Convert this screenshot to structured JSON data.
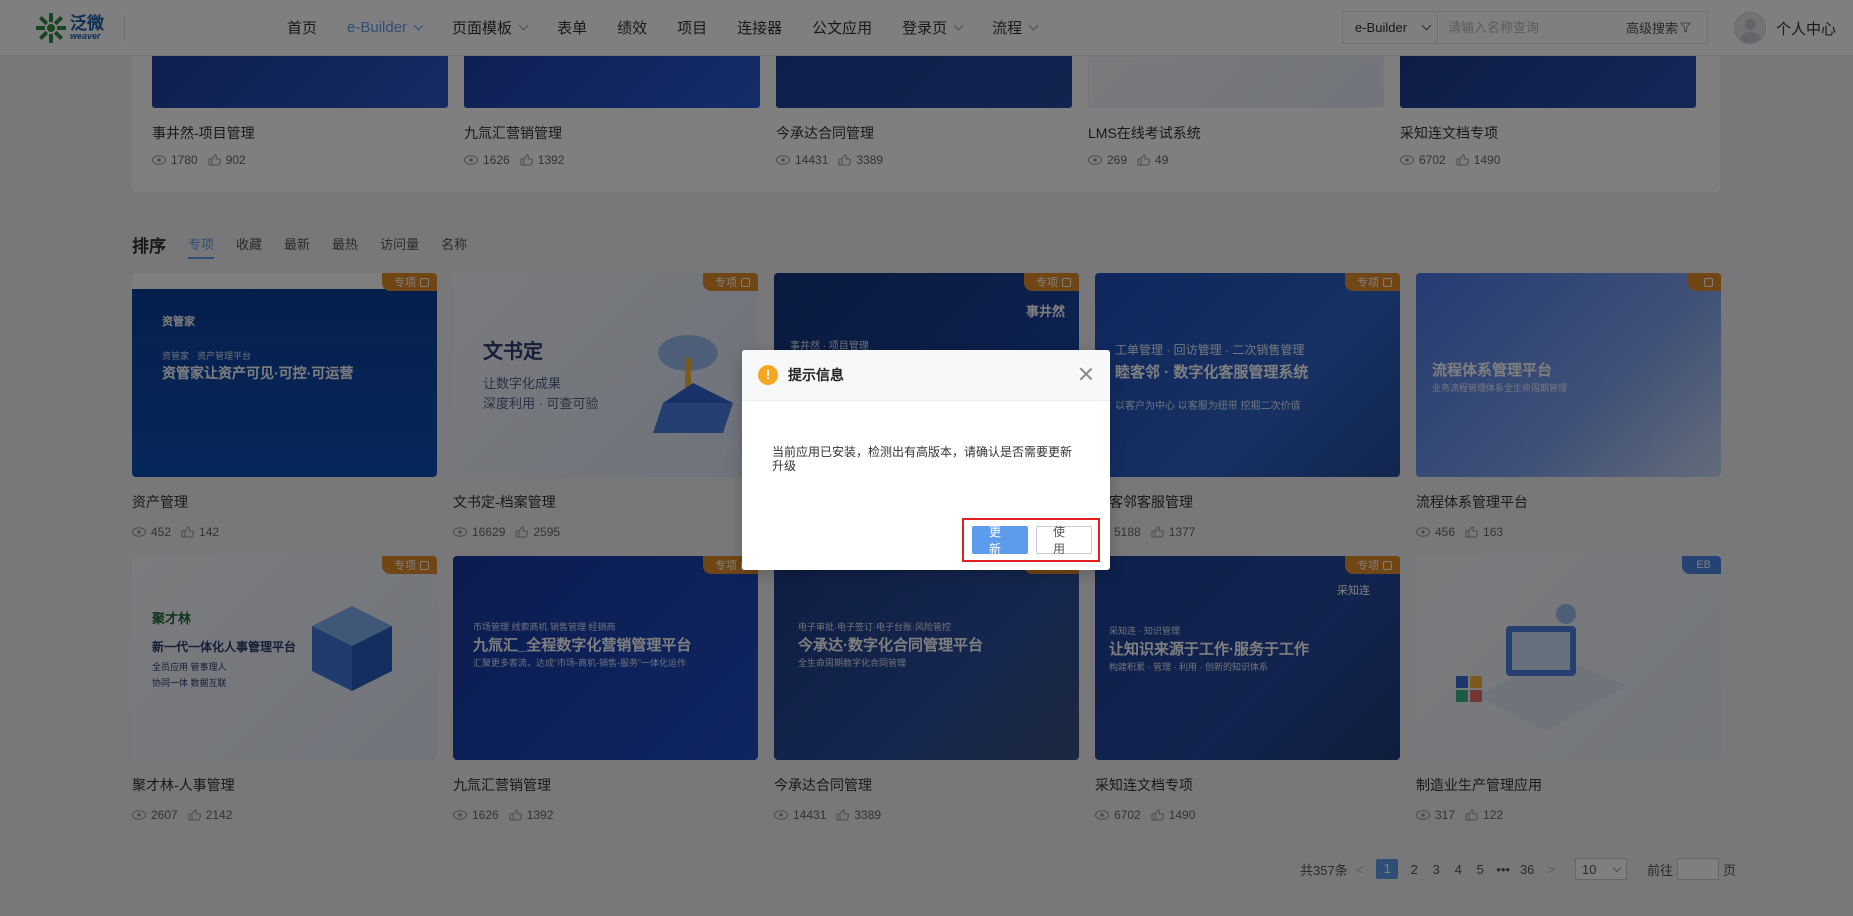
{
  "header": {
    "logo": {
      "cn": "泛微",
      "en": "weaver"
    },
    "nav": [
      {
        "label": "首页",
        "dropdown": false,
        "active": false
      },
      {
        "label": "e-Builder",
        "dropdown": true,
        "active": true
      },
      {
        "label": "页面模板",
        "dropdown": true,
        "active": false
      },
      {
        "label": "表单",
        "dropdown": false,
        "active": false
      },
      {
        "label": "绩效",
        "dropdown": false,
        "active": false
      },
      {
        "label": "项目",
        "dropdown": false,
        "active": false
      },
      {
        "label": "连接器",
        "dropdown": false,
        "active": false
      },
      {
        "label": "公文应用",
        "dropdown": false,
        "active": false
      },
      {
        "label": "登录页",
        "dropdown": true,
        "active": false
      },
      {
        "label": "流程",
        "dropdown": true,
        "active": false
      }
    ],
    "search": {
      "scope": "e-Builder",
      "placeholder": "请输入名称查询",
      "advanced": "高级搜索"
    },
    "user": {
      "label": "个人中心"
    }
  },
  "top_row": [
    {
      "title": "事井然-项目管理",
      "views": "1780",
      "likes": "902"
    },
    {
      "title": "九氚汇营销管理",
      "views": "1626",
      "likes": "1392"
    },
    {
      "title": "今承达合同管理",
      "views": "14431",
      "likes": "3389"
    },
    {
      "title": "LMS在线考试系统",
      "views": "269",
      "likes": "49"
    },
    {
      "title": "采知连文档专项",
      "views": "6702",
      "likes": "1490"
    }
  ],
  "sort": {
    "title": "排序",
    "tabs": [
      "专项",
      "收藏",
      "最新",
      "最热",
      "访问量",
      "名称"
    ],
    "active": 0
  },
  "cards": [
    {
      "title": "资产管理",
      "views": "452",
      "likes": "142",
      "badge": "专项",
      "thumb": {
        "small": "资管家 · 资产管理平台",
        "big": "资管家让资产可见·可控·可运营",
        "brand": "资管家"
      }
    },
    {
      "title": "文书定-档案管理",
      "views": "16629",
      "likes": "2595",
      "badge": "专项",
      "thumb": {
        "big": "文书定",
        "line1": "让数字化成果",
        "line2": "深度利用 · 可查可验"
      }
    },
    {
      "title": "",
      "views": "",
      "likes": "",
      "badge": "专项",
      "thumb": {
        "small": "事井然 · 项目管理",
        "brand": "事井然"
      }
    },
    {
      "title": "睦客邻客服管理",
      "views": "5188",
      "likes": "1377",
      "badge": "专项",
      "thumb": {
        "small": "工单管理 · 回访管理 · 二次销售管理",
        "big": "睦客邻 · 数字化客服管理系统",
        "line1": "以客户为中心   以客服为纽带   挖掘二次价值"
      }
    },
    {
      "title": "流程体系管理平台",
      "views": "456",
      "likes": "163",
      "badge": "",
      "thumb": {
        "big": "流程体系管理平台",
        "small": "业务流程管理体系全生命周期管理"
      }
    },
    {
      "title": "聚才林-人事管理",
      "views": "2607",
      "likes": "2142",
      "badge": "专项",
      "thumb": {
        "brand": "聚才林",
        "big": "新一代一体化人事管理平台",
        "line1": "全员应用   管事理人",
        "line2": "协同一体   数据互联"
      }
    },
    {
      "title": "九氚汇营销管理",
      "views": "1626",
      "likes": "1392",
      "badge": "专项",
      "thumb": {
        "small": "市场管理 线索商机 销售管理 经销商",
        "big": "九氚汇_全程数字化营销管理平台",
        "line1": "汇聚更多客流，达成“市场-商机-销售-服务”一体化运作"
      }
    },
    {
      "title": "今承达合同管理",
      "views": "14431",
      "likes": "3389",
      "badge": "专项",
      "thumb": {
        "small": "电子审批·电子签订·电子台账·风险管控",
        "big": "今承达·数字化合同管理平台",
        "line1": "全生命周期数字化合同管理"
      }
    },
    {
      "title": "采知连文档专项",
      "views": "6702",
      "likes": "1490",
      "badge": "专项",
      "thumb": {
        "brand": "采知连",
        "small": "采知连 · 知识管理",
        "big": "让知识来源于工作·服务于工作",
        "line1": "构建积累 · 管理 · 利用 · 创新的知识体系"
      }
    },
    {
      "title": "制造业生产管理应用",
      "views": "317",
      "likes": "122",
      "badge": "EB",
      "thumb": {}
    }
  ],
  "pager": {
    "total": "共357条",
    "pages": [
      "1",
      "2",
      "3",
      "4",
      "5",
      "•••",
      "36"
    ],
    "current": "1",
    "size": "10",
    "goto": "前往",
    "unit": "页"
  },
  "modal": {
    "title": "提示信息",
    "icon": "warning-icon",
    "message": "当前应用已安装，检测出有高版本，请确认是否需要更新升级",
    "confirm": "更新",
    "cancel": "使用"
  },
  "colors": {
    "accent": "#5d9cec",
    "badge": "#e08d2a",
    "badge_eb": "#4a84e6",
    "highlight": "#e02020",
    "warning": "#f5a623"
  }
}
